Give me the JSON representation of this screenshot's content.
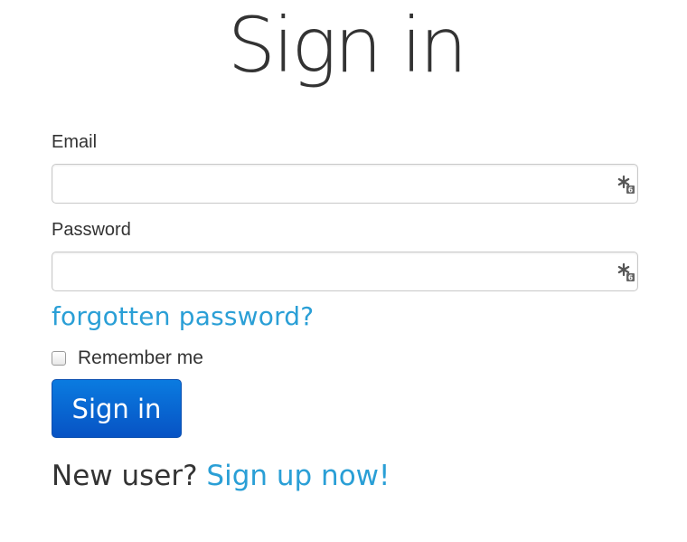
{
  "form": {
    "title": "Sign in",
    "email_label": "Email",
    "email_value": "",
    "password_label": "Password",
    "password_value": "",
    "forgot_link": "forgotten password?",
    "remember_label": "Remember me",
    "remember_checked": false,
    "submit_label": "Sign in",
    "new_user_text": "New user?",
    "signup_link": "Sign up now!"
  },
  "icons": {
    "email_field_icon": "password-manager-icon",
    "password_field_icon": "password-manager-icon"
  },
  "colors": {
    "link": "#2a9fd6",
    "button": "#0753c4",
    "text": "#333333"
  }
}
